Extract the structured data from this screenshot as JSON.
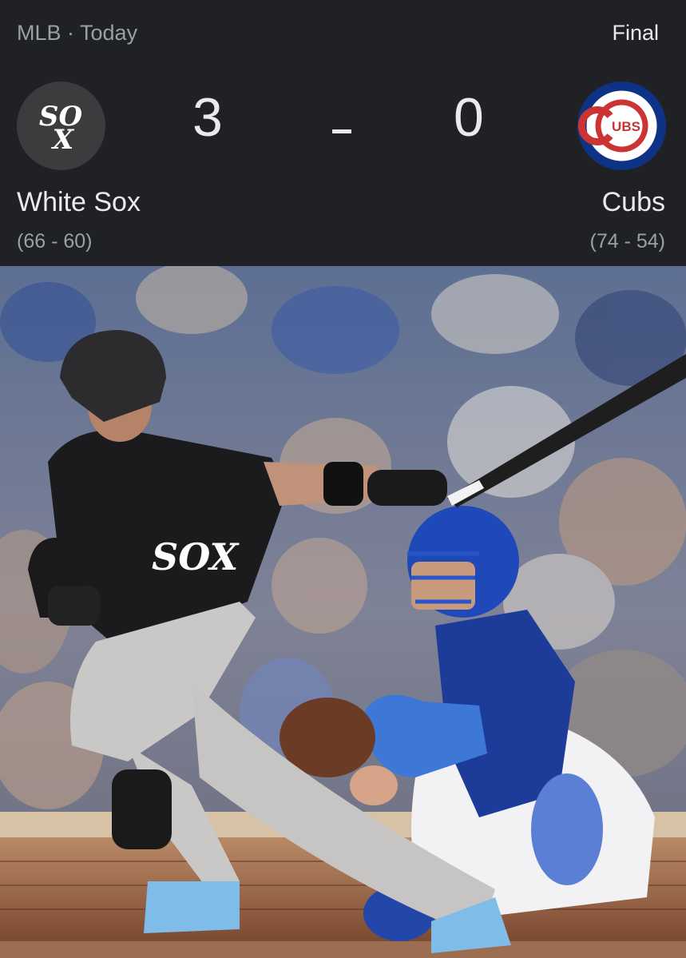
{
  "header": {
    "league": "MLB · Today",
    "status": "Final"
  },
  "teams": {
    "left": {
      "name": "White Sox",
      "record": "(66 - 60)",
      "score": "3",
      "logo_icon": "white-sox-logo"
    },
    "right": {
      "name": "Cubs",
      "record": "(74 - 54)",
      "score": "0",
      "logo_icon": "cubs-logo",
      "logo_text": "UBS"
    }
  },
  "score_separator": "-",
  "photo": {
    "description_icon": "game-action-photo"
  },
  "colors": {
    "background": "#202124",
    "text_primary": "#e8eaed",
    "text_secondary": "#9aa0a6",
    "cubs_blue": "#0e3386",
    "cubs_red": "#cc3433"
  }
}
